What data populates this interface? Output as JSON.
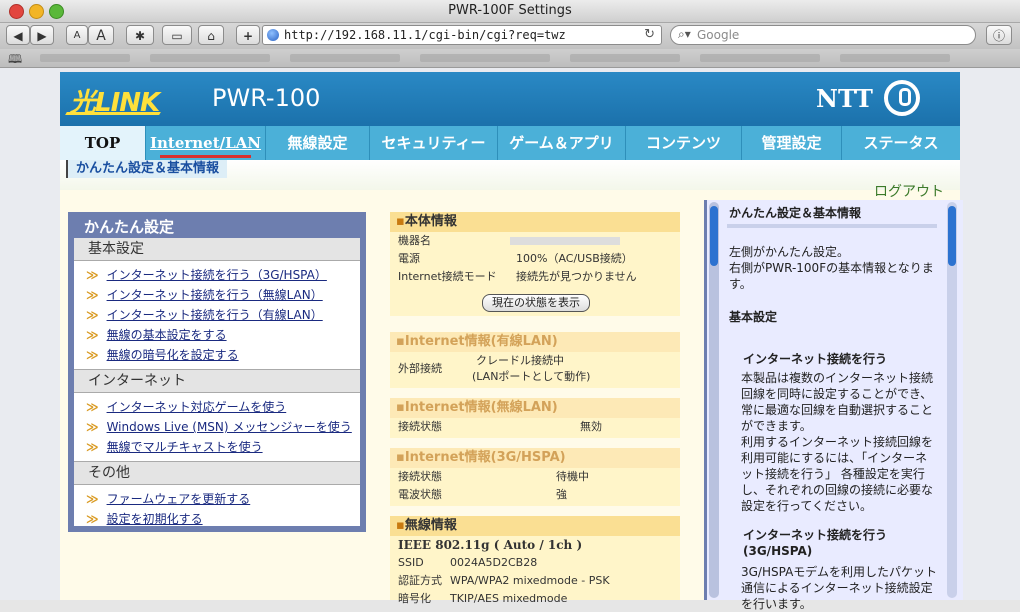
{
  "window": {
    "title": "PWR-100F Settings"
  },
  "toolbar": {
    "nav_back": "◀",
    "nav_forward": "▶",
    "text_smaller": "A",
    "text_larger": "A",
    "url": "http://192.168.11.1/cgi-bin/cgi?req=twz",
    "search_placeholder": "Google"
  },
  "brand": {
    "logo": "光LINK",
    "model": "PWR-100",
    "company": "NTT"
  },
  "nav": {
    "tabs": [
      {
        "label": "TOP"
      },
      {
        "label": "Internet/LAN"
      },
      {
        "label": "無線設定"
      },
      {
        "label": "セキュリティー"
      },
      {
        "label": "ゲーム＆アプリ"
      },
      {
        "label": "コンテンツ"
      },
      {
        "label": "管理設定"
      },
      {
        "label": "ステータス"
      }
    ]
  },
  "subnav": {
    "item": "かんたん設定＆基本情報",
    "logout": "ログアウト"
  },
  "left_panel": {
    "title": "かんたん設定",
    "sections": [
      {
        "title": "基本設定",
        "links": [
          "インターネット接続を行う（3G/HSPA）",
          "インターネット接続を行う（無線LAN）",
          "インターネット接続を行う（有線LAN）",
          "無線の基本設定をする",
          "無線の暗号化を設定する"
        ]
      },
      {
        "title": "インターネット",
        "links": [
          "インターネット対応ゲームを使う",
          "Windows Live (MSN) メッセンジャーを使う",
          "無線でマルチキャストを使う"
        ]
      },
      {
        "title": "その他",
        "links": [
          "ファームウェアを更新する",
          "設定を初期化する"
        ]
      }
    ]
  },
  "info": {
    "device": {
      "title": "本体情報",
      "rows": [
        {
          "k": "機器名",
          "v": ""
        },
        {
          "k": "電源",
          "v": "100%（AC/USB接続）"
        },
        {
          "k": "Internet接続モード",
          "v": "接続先が見つかりません"
        }
      ],
      "button": "現在の状態を表示"
    },
    "wired": {
      "title_prefix": "Internet情報",
      "title_suffix": "(有線LAN)",
      "k": "外部接続",
      "v1": "クレードル接続中",
      "v2": "(LANポートとして動作)"
    },
    "wlan": {
      "title_prefix": "Internet情報",
      "title_suffix": "(無線LAN)",
      "k": "接続状態",
      "v": "無効"
    },
    "hspa": {
      "title_prefix": "Internet情報",
      "title_suffix": "(3G/HSPA)",
      "rows": [
        {
          "k": "接続状態",
          "v": "待機中"
        },
        {
          "k": "電波状態",
          "v": "強"
        }
      ]
    },
    "wireless": {
      "title": "無線情報",
      "standard": "IEEE 802.11g ( Auto / 1ch )",
      "rows": [
        {
          "k": "SSID",
          "v": "0024A5D2CB28"
        },
        {
          "k": "認証方式",
          "v": "WPA/WPA2 mixedmode - PSK"
        },
        {
          "k": "暗号化",
          "v": "TKIP/AES mixedmode"
        }
      ]
    }
  },
  "help": {
    "title": "かんたん設定＆基本情報",
    "intro1": "左側がかんたん設定。",
    "intro2": "右側がPWR-100Fの基本情報となります。",
    "h1": "基本設定",
    "h2": "インターネット接続を行う",
    "p2": "本製品は複数のインターネット接続回線を同時に設定することができ、常に最適な回線を自動選択することができます。",
    "p3": "利用するインターネット接続回線を利用可能にするには、「インターネット接続を行う」 各種設定を実行し、それぞれの回線の接続に必要な設定を行ってください。",
    "h3": "インターネット接続を行う",
    "h3b": "(3G/HSPA)",
    "p4": "3G/HSPAモデムを利用したパケット通信によるインターネット接続設定を行います。"
  }
}
